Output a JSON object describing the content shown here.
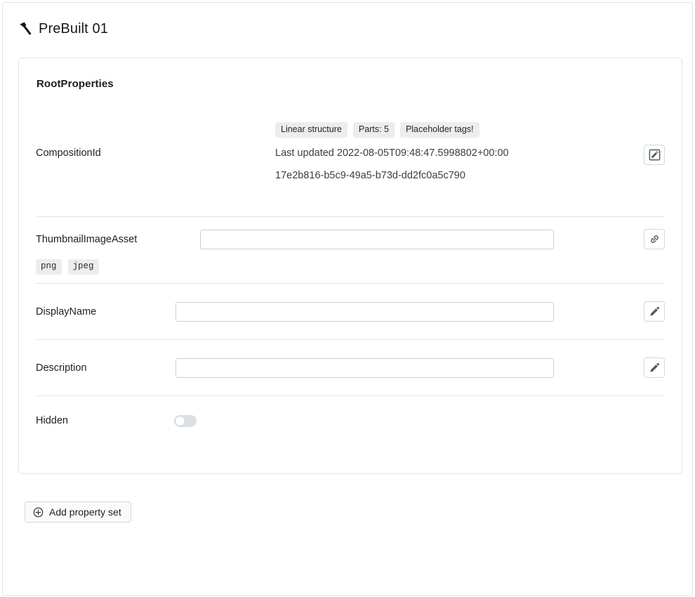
{
  "header": {
    "title": "PreBuilt 01",
    "icon": "hammer-icon"
  },
  "card": {
    "heading": "RootProperties",
    "rows": {
      "composition": {
        "label": "CompositionId",
        "tags": [
          "Linear structure",
          "Parts: 5",
          "Placeholder tags!"
        ],
        "last_updated": "Last updated 2022-08-05T09:48:47.5998802+00:00",
        "guid": "17e2b816-b5c9-49a5-b73d-dd2fc0a5c790",
        "action_icon": "pencil-square-icon"
      },
      "thumbnail": {
        "label": "ThumbnailImageAsset",
        "value": "",
        "placeholder": "",
        "format_tags": [
          "png",
          "jpeg"
        ],
        "action_icon": "link-icon"
      },
      "display_name": {
        "label": "DisplayName",
        "value": "",
        "placeholder": "",
        "action_icon": "pencil-icon"
      },
      "description": {
        "label": "Description",
        "value": "",
        "placeholder": "",
        "action_icon": "pencil-icon"
      },
      "hidden": {
        "label": "Hidden",
        "toggle_on": false
      }
    }
  },
  "footer": {
    "add_property_set_label": "Add property set",
    "add_icon": "plus-circle-icon"
  },
  "colors": {
    "text": "#1f1f1f",
    "muted_text": "#3d3d3d",
    "tag_bg": "#eceded",
    "border": "#e4e4e4",
    "input_border": "#cfcfcf",
    "icon": "#4a5a68",
    "toggle_track": "#dcdfe3"
  }
}
